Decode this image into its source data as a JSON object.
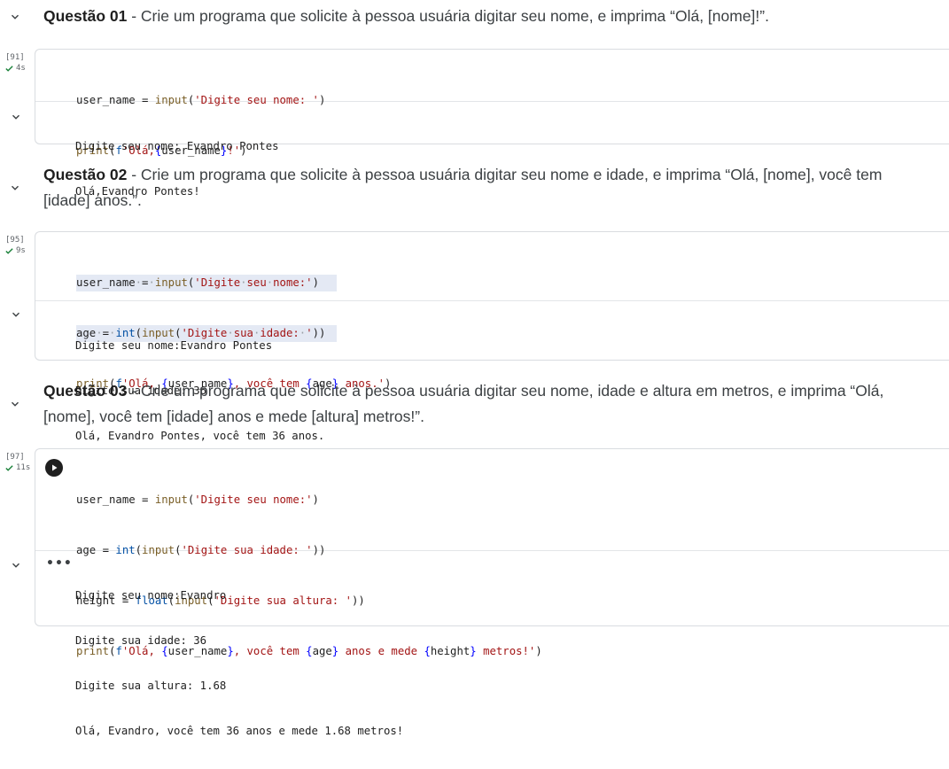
{
  "questions": [
    {
      "title": "Questão 01",
      "text_line1": " - Crie um programa que solicite à pessoa usuária digitar seu nome, e imprima “Olá, [nome]!”.",
      "text_line2": "",
      "exec_count": "[91]",
      "exec_time": "4s",
      "code": [
        "user_name = input('Digite seu nome: ')",
        "print(f'Olá,{user_name}!')"
      ],
      "output": [
        "Digite seu nome: Evandro Pontes",
        "Olá,Evandro Pontes!"
      ]
    },
    {
      "title": "Questão 02",
      "text_line1": " - Crie um programa que solicite à pessoa usuária digitar seu nome e idade, e imprima “Olá, [nome], você tem",
      "text_line2": "[idade] anos.”.",
      "exec_count": "[95]",
      "exec_time": "9s",
      "code": [
        "user_name = input('Digite seu nome:')",
        "age = int(input('Digite sua idade: '))",
        "print(f'Olá, {user_name}, você tem {age} anos.')"
      ],
      "output": [
        "Digite seu nome:Evandro Pontes",
        "Digite sua idade: 36",
        "Olá, Evandro Pontes, você tem 36 anos."
      ]
    },
    {
      "title": "Questão 03",
      "text_line1": " - Crie um programa que solicite à pessoa usuária digitar seu nome, idade e altura em metros, e imprima “Olá,",
      "text_line2": "[nome], você tem [idade] anos e mede [altura] metros!”.",
      "exec_count": "[97]",
      "exec_time": "11s",
      "code": [
        "user_name = input('Digite seu nome:')",
        "age = int(input('Digite sua idade: '))",
        "height = float(input('Digite sua altura: '))",
        "print(f'Olá, {user_name}, você tem {age} anos e mede {height} metros!')"
      ],
      "output": [
        "Digite seu nome:Evandro",
        "Digite sua idade: 36",
        "Digite sua altura: 1.68",
        "Olá, Evandro, você tem 36 anos e mede 1.68 metros!"
      ]
    }
  ],
  "icons": {
    "collapse": "chevron-down-icon",
    "status": "check-icon",
    "run": "play-icon",
    "more": "more-horizontal-icon"
  },
  "colors": {
    "status_green": "#188038",
    "string": "#a31515",
    "function": "#795e26",
    "builtin": "#0451a5"
  }
}
